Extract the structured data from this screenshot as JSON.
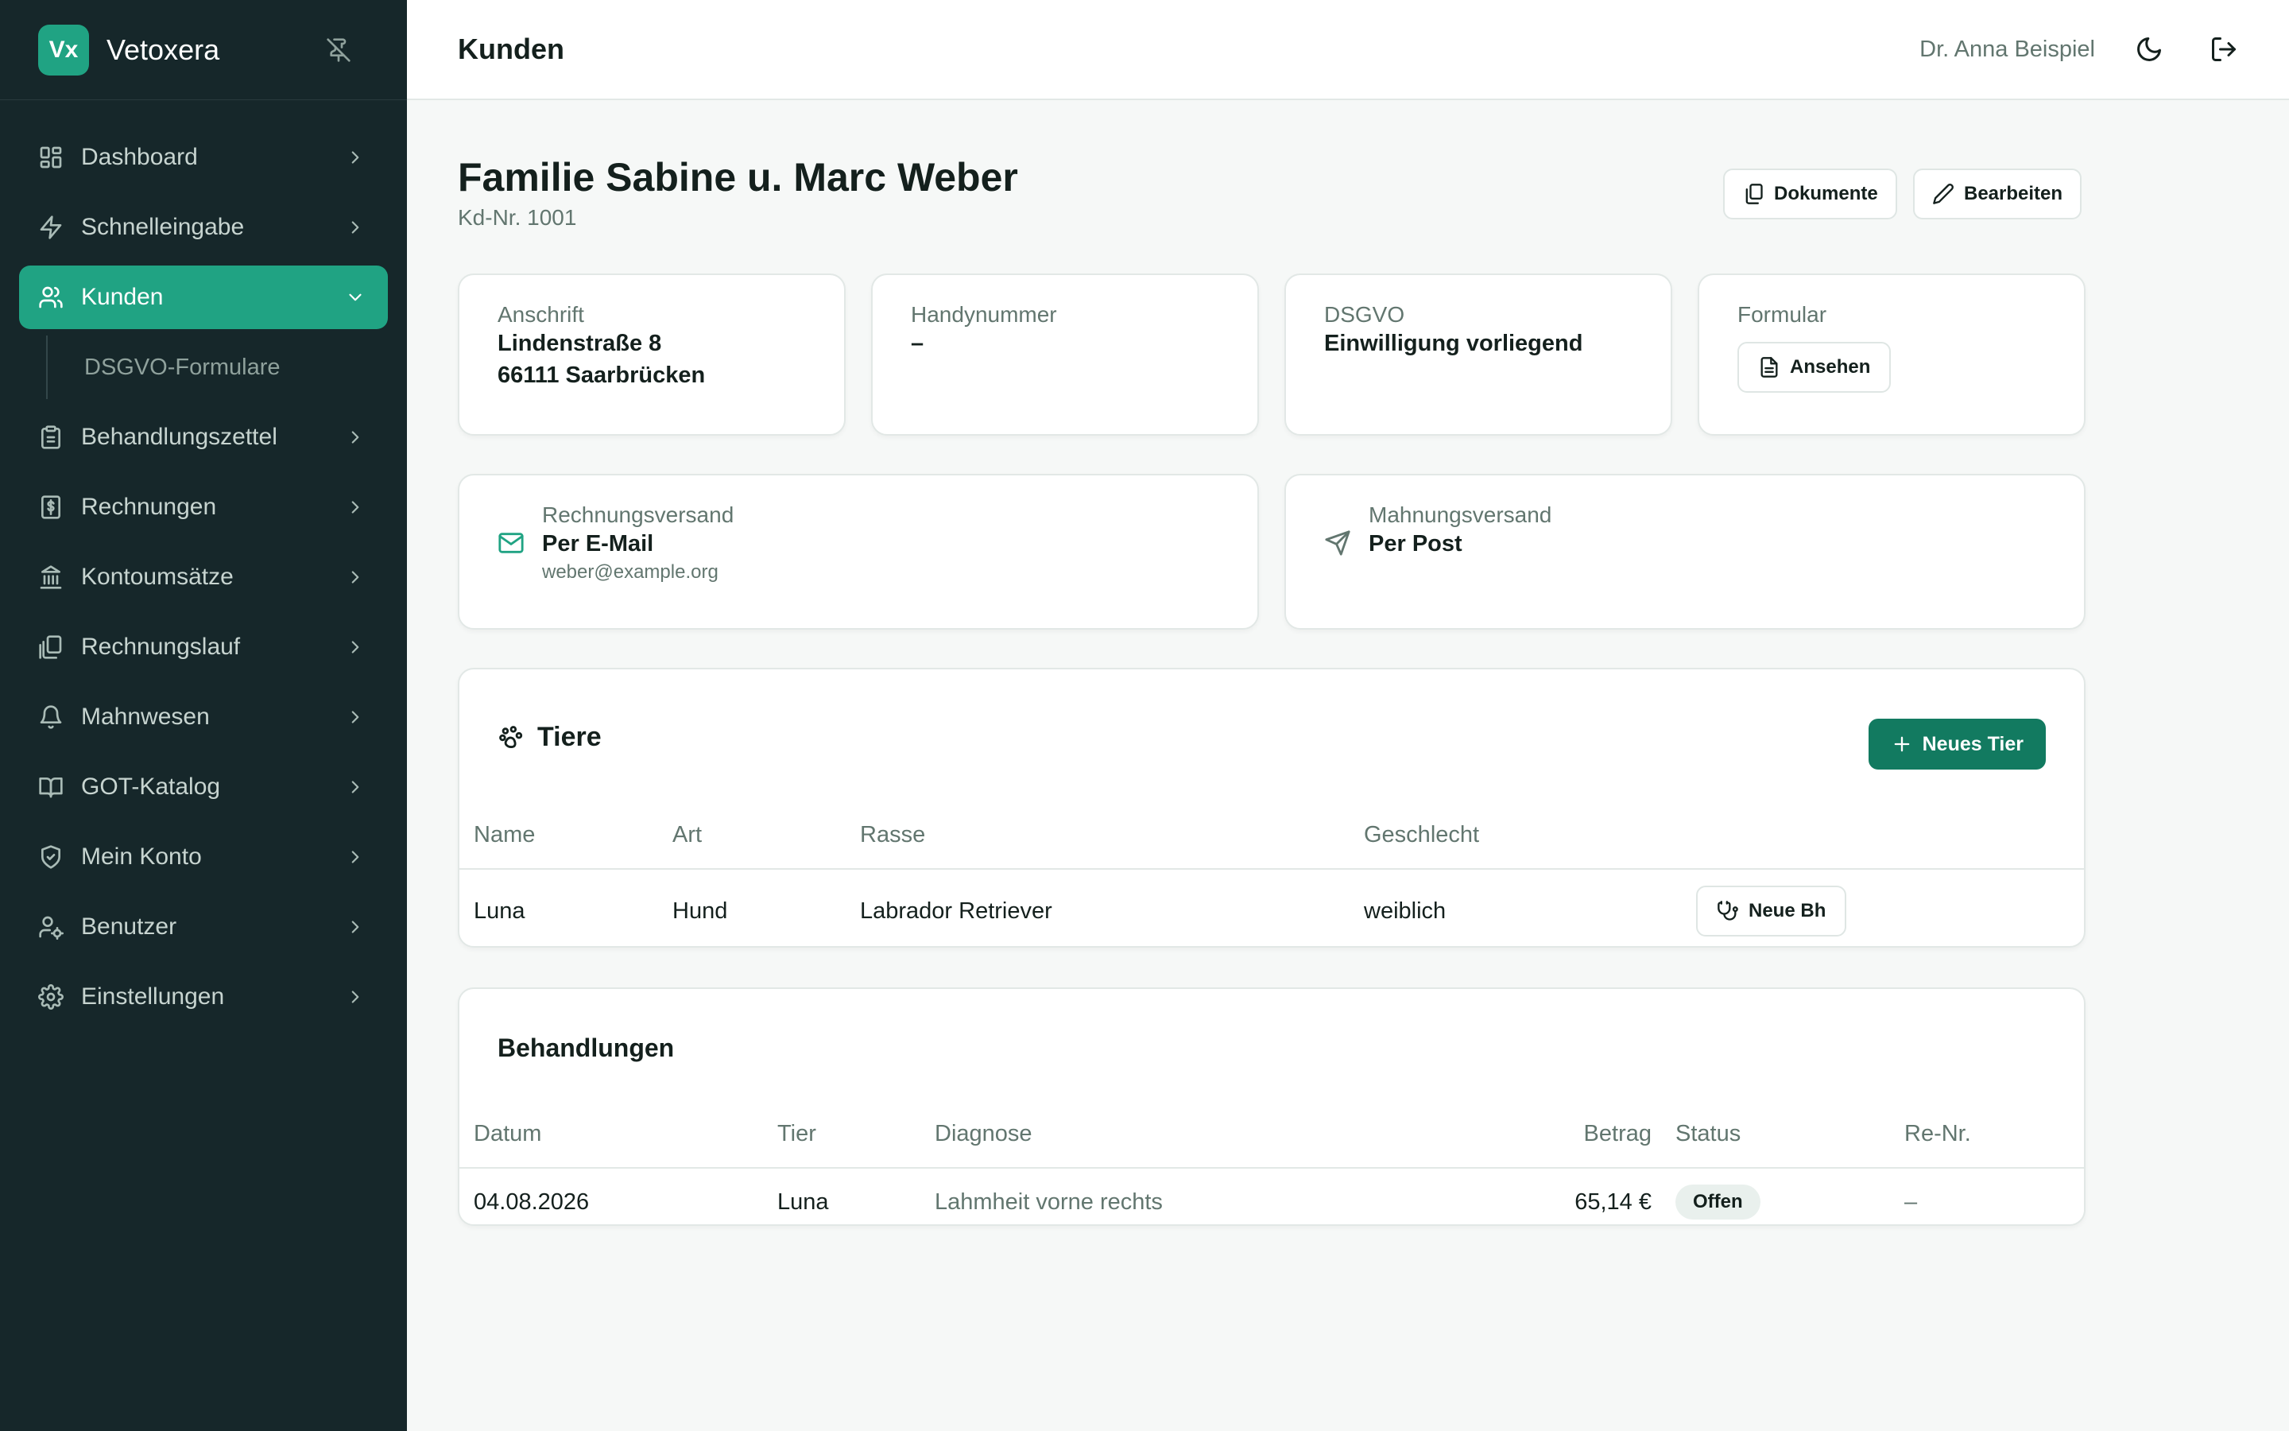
{
  "app": {
    "logo": "Vx",
    "name": "Vetoxera"
  },
  "sidebar": {
    "items": [
      {
        "label": "Dashboard",
        "icon": "dashboard-icon"
      },
      {
        "label": "Schnelleingabe",
        "icon": "lightning-icon"
      },
      {
        "label": "Kunden",
        "icon": "users-icon",
        "active": true
      },
      {
        "label": "DSGVO-Formulare",
        "sub": true
      },
      {
        "label": "Behandlungszettel",
        "icon": "clipboard-icon"
      },
      {
        "label": "Rechnungen",
        "icon": "invoice-icon"
      },
      {
        "label": "Kontoumsätze",
        "icon": "bank-icon"
      },
      {
        "label": "Rechnungslauf",
        "icon": "copies-icon"
      },
      {
        "label": "Mahnwesen",
        "icon": "bell-icon"
      },
      {
        "label": "GOT-Katalog",
        "icon": "book-icon"
      },
      {
        "label": "Mein Konto",
        "icon": "shield-icon"
      },
      {
        "label": "Benutzer",
        "icon": "user-cog-icon"
      },
      {
        "label": "Einstellungen",
        "icon": "gear-icon"
      }
    ]
  },
  "header": {
    "title": "Kunden",
    "user": "Dr. Anna Beispiel"
  },
  "customer": {
    "name": "Familie Sabine u. Marc Weber",
    "number": "Kd-Nr. 1001",
    "docs_label": "Dokumente",
    "edit_label": "Bearbeiten",
    "address": {
      "label": "Anschrift",
      "line1": "Lindenstraße 8",
      "line2": "66111 Saarbrücken"
    },
    "phone": {
      "label": "Handynummer",
      "value": "–"
    },
    "dsgvo": {
      "label": "DSGVO",
      "value": "Einwilligung vorliegend"
    },
    "form": {
      "label": "Formular",
      "button": "Ansehen"
    },
    "invoice_delivery": {
      "label": "Rechnungsversand",
      "value": "Per E-Mail",
      "email": "weber@example.org"
    },
    "reminder_delivery": {
      "label": "Mahnungsversand",
      "value": "Per Post"
    }
  },
  "animals": {
    "title": "Tiere",
    "new_button": "Neues Tier",
    "columns": [
      "Name",
      "Art",
      "Rasse",
      "Geschlecht"
    ],
    "rows": [
      {
        "name": "Luna",
        "species": "Hund",
        "breed": "Labrador Retriever",
        "sex": "weiblich",
        "action": "Neue Bh"
      }
    ]
  },
  "treatments": {
    "title": "Behandlungen",
    "columns": [
      "Datum",
      "Tier",
      "Diagnose",
      "Betrag",
      "Status",
      "Re-Nr."
    ],
    "rows": [
      {
        "date": "04.08.2026",
        "animal": "Luna",
        "diagnosis": "Lahmheit vorne rechts",
        "amount": "65,14 €",
        "status": "Offen",
        "invoice_nr": "–"
      }
    ]
  },
  "colors": {
    "accent": "#20a383",
    "sidebar_bg": "#16272a",
    "primary_button": "#127a60"
  }
}
